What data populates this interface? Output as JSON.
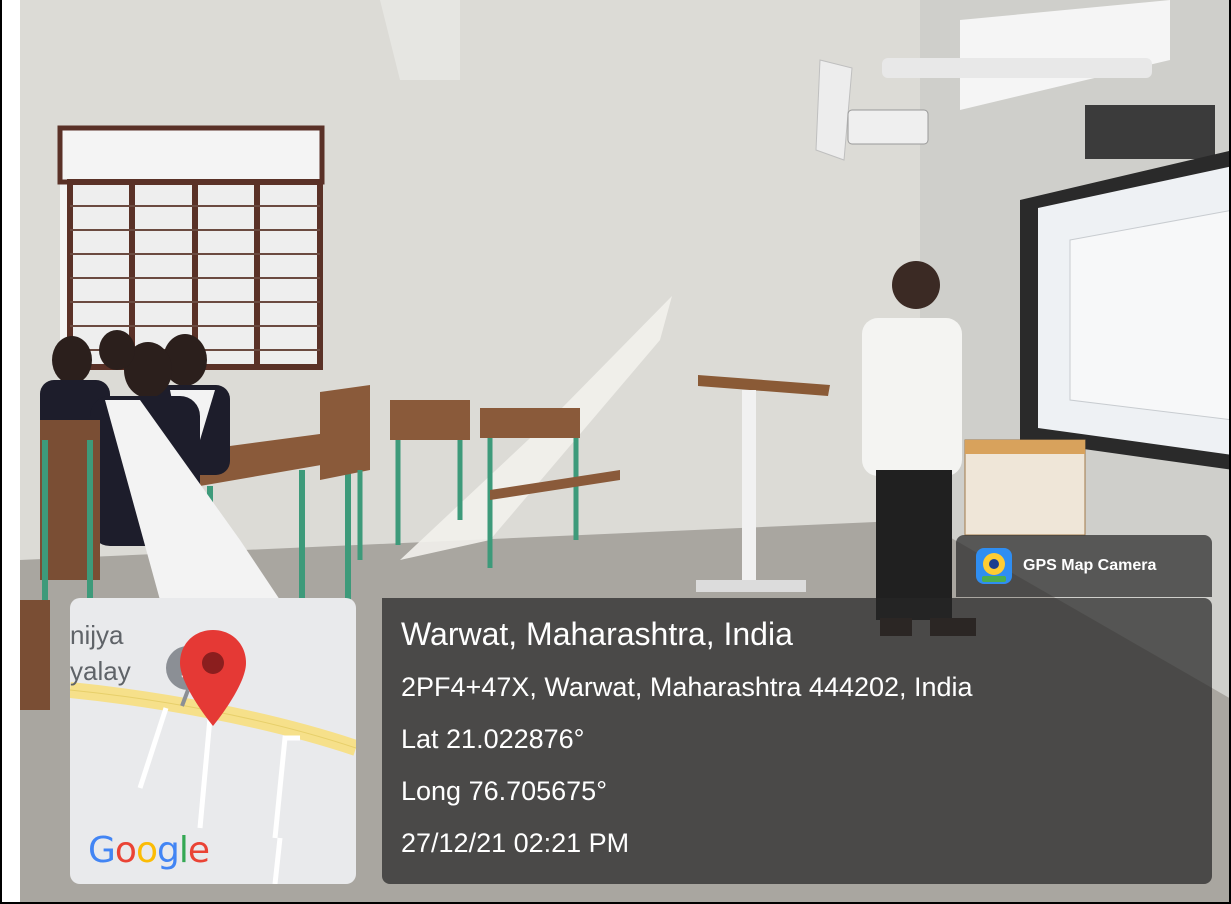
{
  "overlay": {
    "app_badge": "GPS Map Camera",
    "location_title": "Warwat, Maharashtra, India",
    "address": "2PF4+47X, Warwat, Maharashtra 444202, India",
    "latitude": "Lat 21.022876°",
    "longitude": "Long 76.705675°",
    "datetime": "27/12/21 02:21 PM"
  },
  "map": {
    "place_fragment_1": "nijya",
    "place_fragment_2": "yalay",
    "logo_letters": [
      "G",
      "o",
      "o",
      "g",
      "l",
      "e"
    ],
    "logo_colors": [
      "#4285F4",
      "#EA4335",
      "#FBBC05",
      "#4285F4",
      "#34A853",
      "#EA4335"
    ],
    "pin_color": "#E53935",
    "road_color": "#F6E08A"
  },
  "colors": {
    "overlay_bg": "#262626",
    "overlay_text": "#ffffff"
  }
}
